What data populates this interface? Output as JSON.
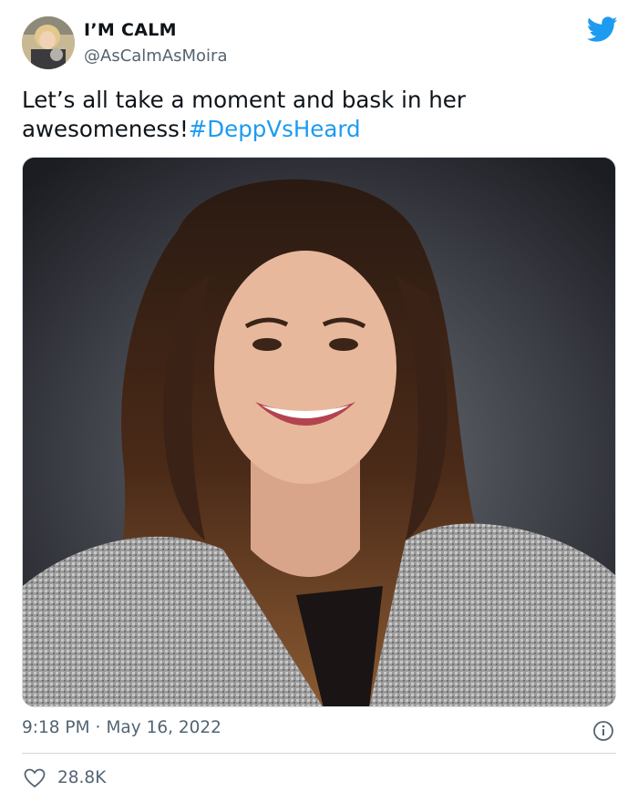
{
  "tweet": {
    "display_name": "I’M CALM",
    "handle": "@AsCalmAsMoira",
    "text_plain": "Let’s all take a moment and bask in her awesomeness!",
    "hashtag": "#DeppVsHeard",
    "time": "9:18 PM",
    "separator": "·",
    "date": "May 16, 2022",
    "likes": "28.8K"
  },
  "icons": {
    "brand": "twitter-bird-icon",
    "info": "info-icon",
    "like": "heart-icon",
    "avatar": "avatar-photo"
  },
  "colors": {
    "link": "#1d9bf0",
    "secondary_text": "#536471",
    "primary_text": "#0f1419",
    "divider": "#cfd9de"
  }
}
